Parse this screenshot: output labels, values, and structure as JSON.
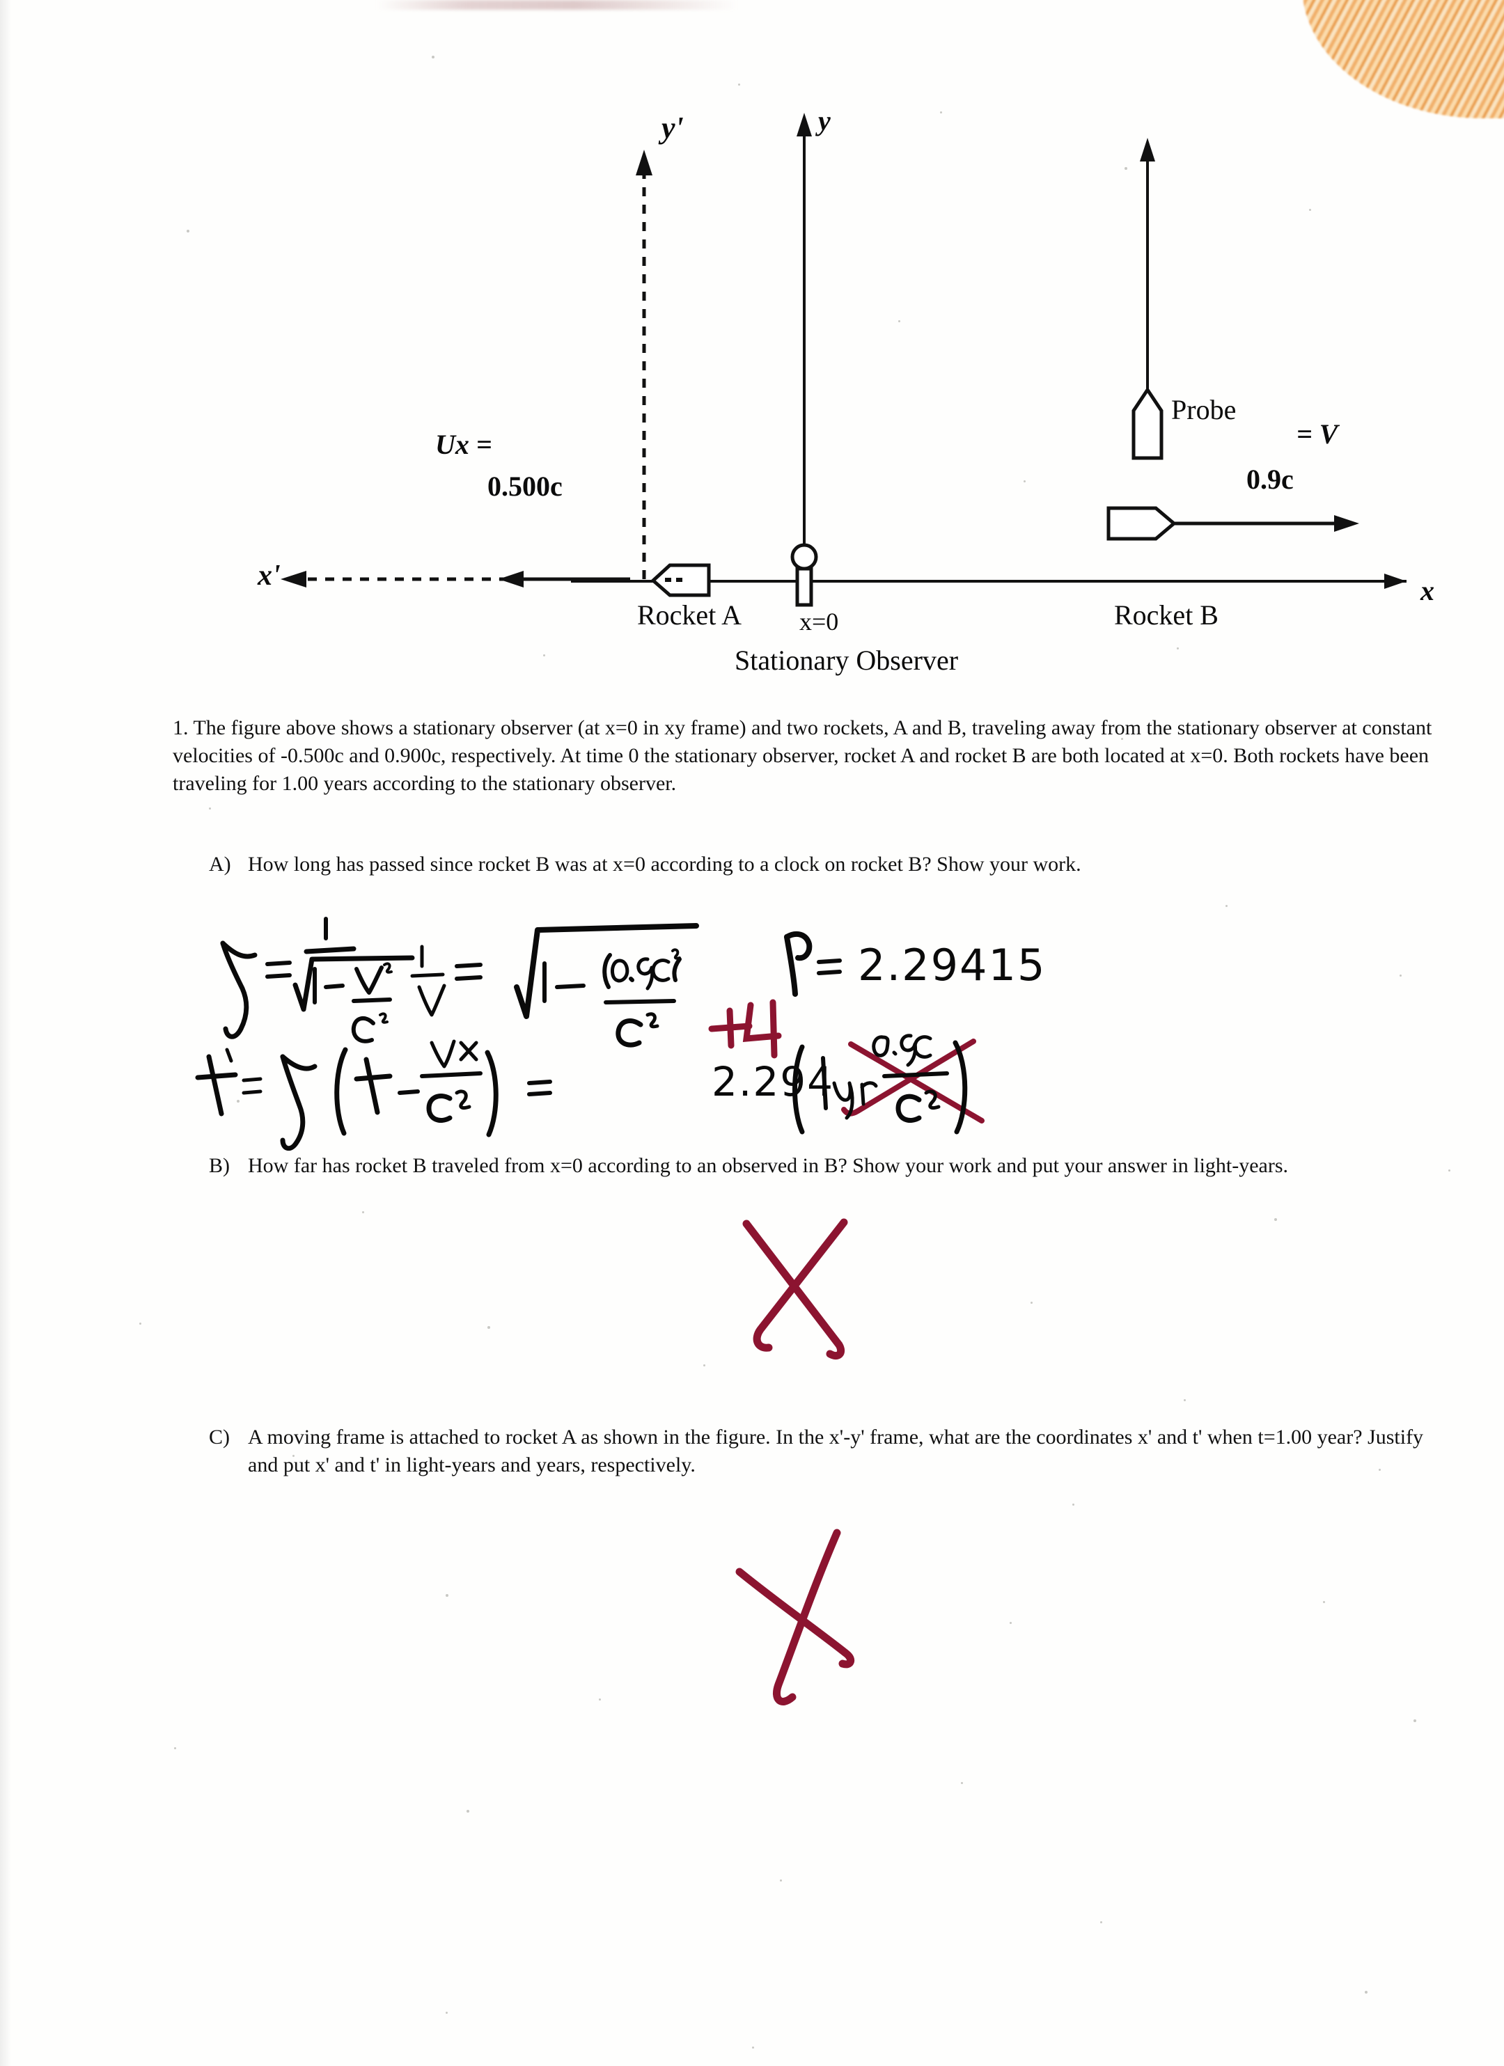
{
  "document": {
    "type": "scanned-physics-worksheet",
    "page_background": "#fefefd",
    "ink_color": "#0a0a0a",
    "grading_color": "#8c1430",
    "corner_artifact_color": "#f0a95e"
  },
  "figure": {
    "caption_labels": {
      "y_prime_axis": "y'",
      "y_axis": "y",
      "x_prime_axis": "x'",
      "x_axis": "x",
      "rocket_a_velocity_symbol": "Ux =",
      "rocket_a_velocity_value": "0.500c",
      "rocket_a_name": "Rocket A",
      "origin_label": "x=0",
      "observer_label": "Stationary Observer",
      "probe_label": "Probe",
      "probe_velocity_symbol": "= V",
      "rocket_b_velocity_value": "0.9c",
      "rocket_b_name": "Rocket B"
    }
  },
  "problem": {
    "number": "1.",
    "intro": "The figure above shows a stationary observer (at x=0 in xy frame) and two rockets, A and B, traveling away from the stationary observer at constant velocities of -0.500c and 0.900c, respectively. At time 0 the stationary observer, rocket A and rocket B are both located at x=0. Both rockets have been traveling for 1.00 years according to the stationary observer.",
    "parts": [
      {
        "marker": "A)",
        "text": "How long has passed since rocket B was at x=0 according to a clock on rocket B? Show your work."
      },
      {
        "marker": "B)",
        "text": "How far has rocket B traveled from x=0 according to an observed in B? Show your work and put your answer in light-years."
      },
      {
        "marker": "C)",
        "text": "A moving frame is attached to rocket A as shown in the figure. In the x'-y' frame, what are the coordinates x' and t' when t=1.00 year? Justify and put x' and t' in light-years and years, respectively."
      }
    ]
  },
  "handwritten_work": {
    "part_a": {
      "line1": {
        "gamma_symbol": "γ",
        "equals": "=",
        "expr_numerator": "1",
        "expr_denominator_generic": "1 - v²/c²",
        "expr_denominator_substituted": "1 - (0.9c)²/c²",
        "middle_fraction": "1 / v",
        "result_symbol": "γ =",
        "result_value": "2.29415"
      },
      "line2": {
        "lhs": "t' =",
        "gamma": "γ",
        "expr": "( t - vx/c² )",
        "equals": "=",
        "substituted_gamma": "2.294",
        "substituted_open": "( 1yr",
        "substituted_fraction": "0.9c / c²",
        "substituted_close": ")"
      }
    },
    "grading_marks": [
      {
        "mark": "+4",
        "location": "part-a",
        "color": "#8c1430"
      },
      {
        "mark": "X",
        "location": "crossed-out-term-part-a",
        "color": "#8c1430"
      },
      {
        "mark": "X",
        "location": "part-b-answer-area",
        "color": "#8c1430"
      },
      {
        "mark": "X",
        "location": "part-c-answer-area",
        "color": "#8c1430"
      }
    ]
  }
}
